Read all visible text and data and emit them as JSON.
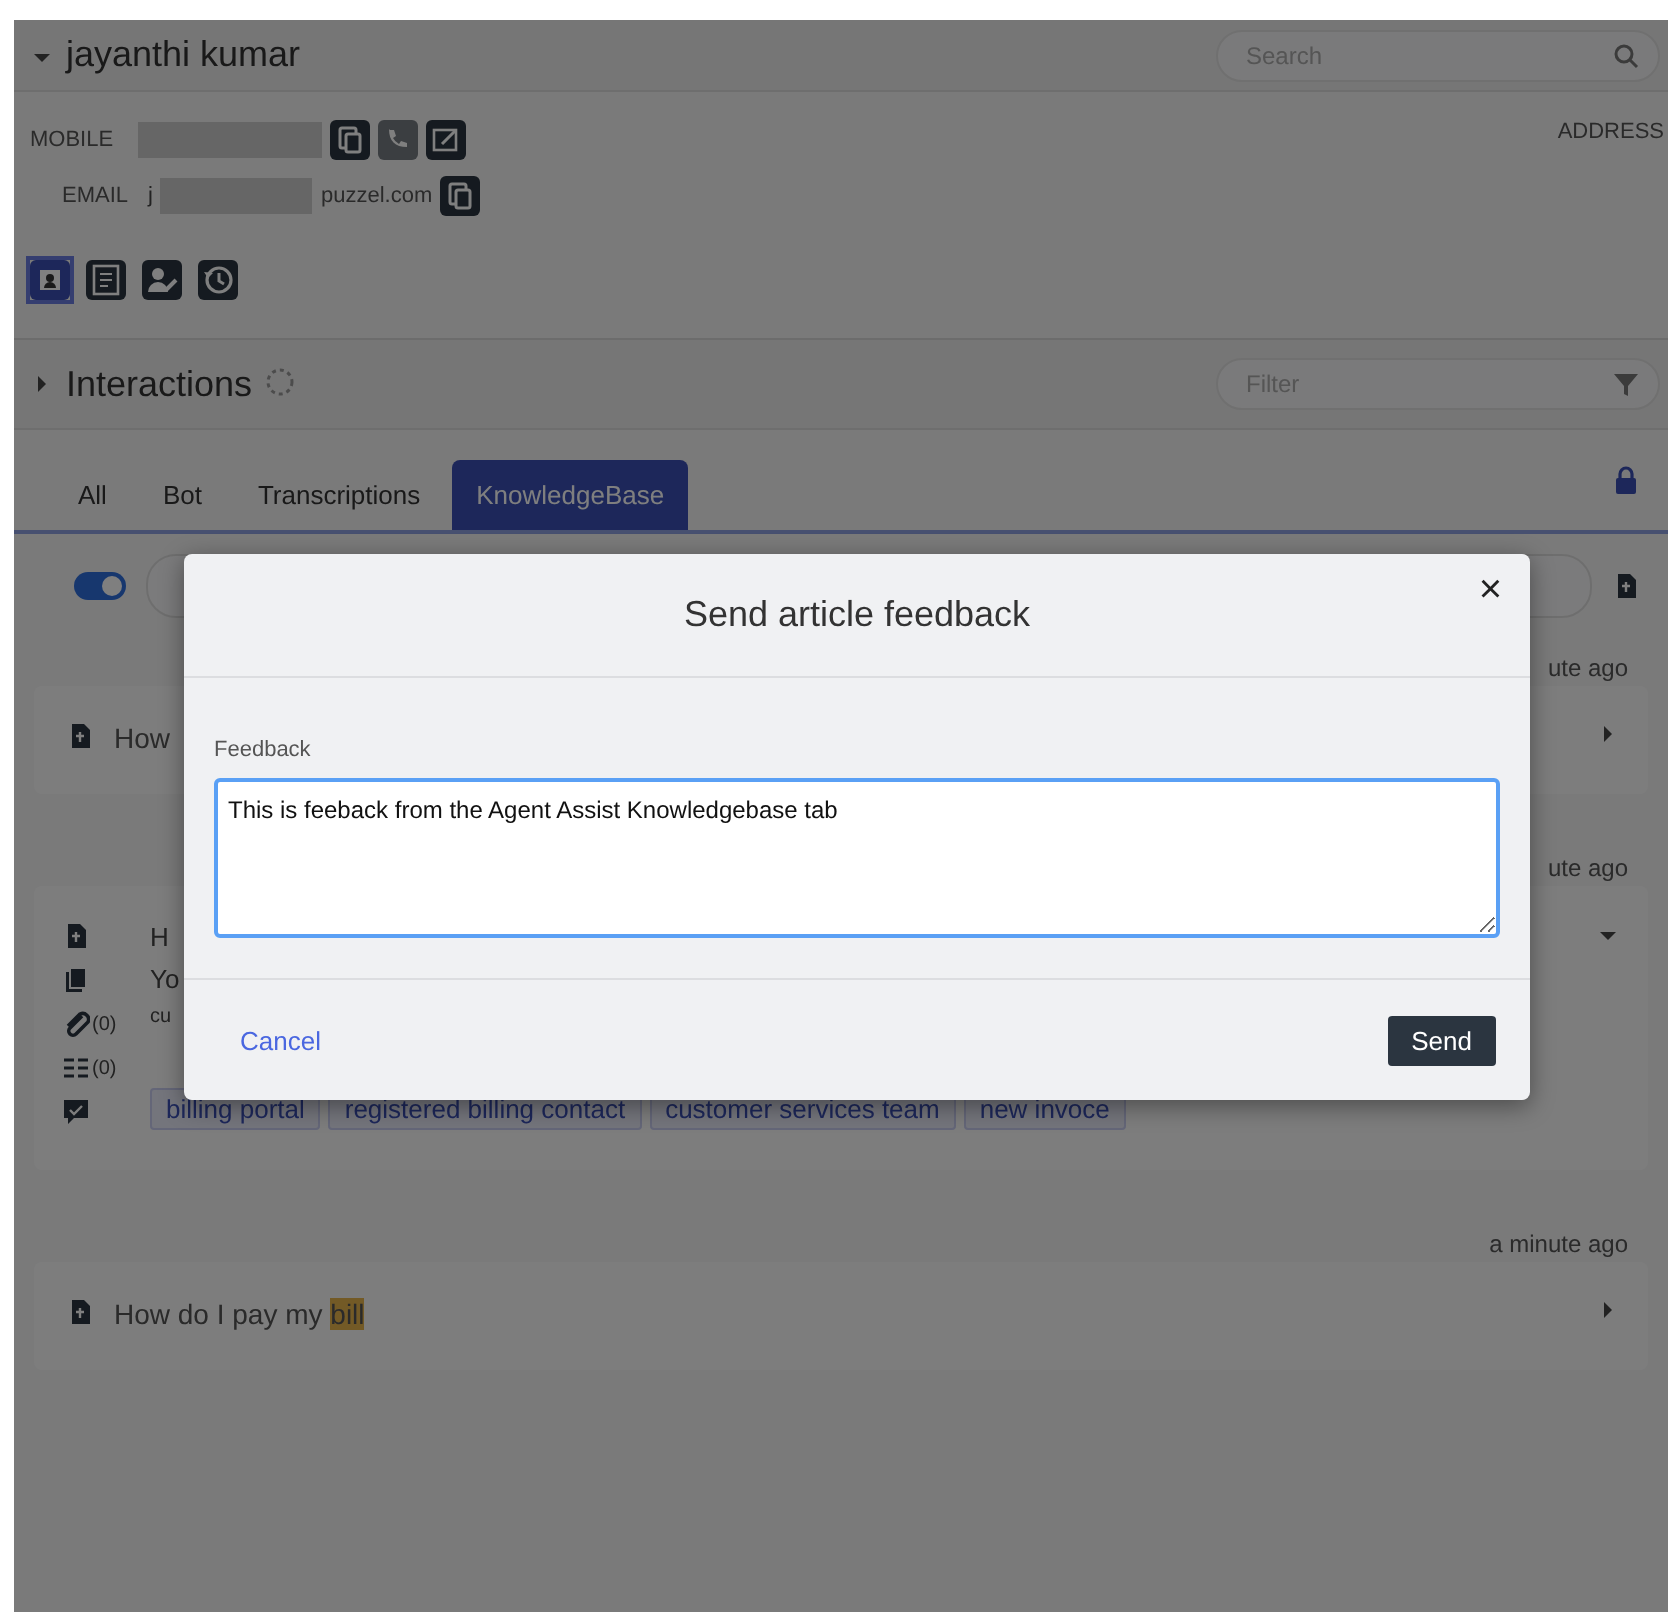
{
  "contact": {
    "name": "jayanthi kumar",
    "expanded": true,
    "search": {
      "placeholder": "Search"
    },
    "mobile_label": "MOBILE",
    "email_label": "EMAIL",
    "email_start": "j",
    "email_end": "puzzel.com",
    "address_label": "ADDRESS",
    "views": [
      {
        "selected": true
      },
      {
        "selected": false
      },
      {
        "selected": false
      },
      {
        "selected": false
      }
    ]
  },
  "interactions": {
    "title": "Interactions",
    "expanded": false,
    "filter": {
      "placeholder": "Filter"
    }
  },
  "tabs": [
    {
      "label": "All",
      "selected": false
    },
    {
      "label": "Bot",
      "selected": false
    },
    {
      "label": "Transcriptions",
      "selected": false
    },
    {
      "label": "KnowledgeBase",
      "selected": true
    }
  ],
  "knowledge": {
    "toggle_on": true,
    "results": [
      {
        "time": "ute ago",
        "title": "How",
        "expanded": false
      },
      {
        "time": "ute ago",
        "title": "H",
        "expanded": true,
        "lines": [
          "Yo",
          "cu"
        ],
        "attachments": "(0)",
        "related": "(0)",
        "tags": [
          "billing portal",
          "registered billing contact",
          "customer services team",
          "new invoce"
        ]
      },
      {
        "time": "a minute ago",
        "title": "How do I pay my",
        "highlight": "bill",
        "expanded": false
      }
    ]
  },
  "dialog": {
    "title": "Send article feedback",
    "close": "×",
    "field_label": "Feedback",
    "value": "This is feeback from the Agent Assist Knowledgebase tab",
    "cancel": "Cancel",
    "send": "Send"
  }
}
